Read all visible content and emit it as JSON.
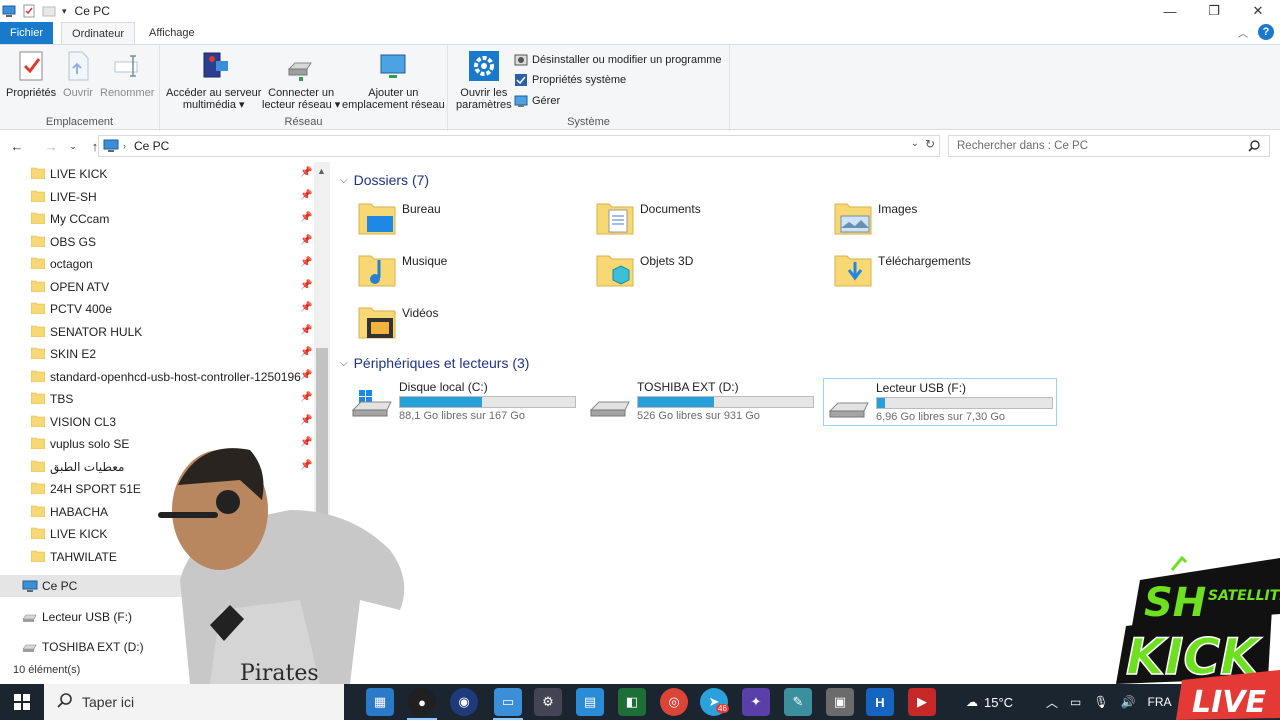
{
  "window": {
    "title": "Ce PC",
    "controls": {
      "minimize": "—",
      "maximize": "❐",
      "close": "✕"
    }
  },
  "ribbon_tabs": [
    {
      "label": "Fichier",
      "style": "file"
    },
    {
      "label": "Ordinateur",
      "style": "active"
    },
    {
      "label": "Affichage",
      "style": "normal"
    }
  ],
  "ribbon": {
    "emplacement": {
      "label": "Emplacement",
      "buttons": [
        {
          "label": "Propriétés",
          "icon": "properties-icon",
          "enabled": true
        },
        {
          "label": "Ouvrir",
          "icon": "open-icon",
          "enabled": false
        },
        {
          "label": "Renommer",
          "icon": "rename-icon",
          "enabled": false
        }
      ]
    },
    "reseau": {
      "label": "Réseau",
      "media": {
        "line1": "Accéder au serveur",
        "line2": "multimédia ▾"
      },
      "connect": {
        "line1": "Connecter un",
        "line2": "lecteur réseau ▾"
      },
      "add": {
        "line1": "Ajouter un",
        "line2": "emplacement réseau"
      }
    },
    "systeme": {
      "label": "Système",
      "settings": {
        "line1": "Ouvrir les",
        "line2": "paramètres"
      },
      "small": [
        {
          "label": "Désinstaller ou modifier un programme",
          "icon": "uninstall-icon"
        },
        {
          "label": "Propriétés système",
          "icon": "system-properties-icon"
        },
        {
          "label": "Gérer",
          "icon": "manage-icon"
        }
      ]
    }
  },
  "address": {
    "path": "Ce PC",
    "search_placeholder": "Rechercher dans : Ce PC"
  },
  "nav_pane": {
    "quick_access": [
      {
        "label": "LIVE KICK",
        "pinned": true
      },
      {
        "label": "LIVE-SH",
        "pinned": true
      },
      {
        "label": "My CCcam",
        "pinned": true
      },
      {
        "label": "OBS GS",
        "pinned": true
      },
      {
        "label": "octagon",
        "pinned": true
      },
      {
        "label": "OPEN ATV",
        "pinned": true
      },
      {
        "label": "PCTV 400e",
        "pinned": true
      },
      {
        "label": "SENATOR HULK",
        "pinned": true
      },
      {
        "label": "SKIN E2",
        "pinned": true
      },
      {
        "label": "standard-openhcd-usb-host-controller-1250196",
        "pinned": true
      },
      {
        "label": "TBS",
        "pinned": true
      },
      {
        "label": "VISION CL3",
        "pinned": true
      },
      {
        "label": "vuplus solo SE",
        "pinned": true
      },
      {
        "label": "معطيات الطبق",
        "pinned": true
      },
      {
        "label": "24H SPORT 51E",
        "pinned": false
      },
      {
        "label": "HABACHA",
        "pinned": false
      },
      {
        "label": "LIVE KICK",
        "pinned": false
      },
      {
        "label": "TAHWILATE",
        "pinned": false
      }
    ],
    "this_pc": "Ce PC",
    "devices": [
      {
        "label": "Lecteur USB (F:)"
      },
      {
        "label": "TOSHIBA EXT (D:)"
      }
    ]
  },
  "status": {
    "items": "10 élément(s)"
  },
  "content": {
    "folders_header": "Dossiers (7)",
    "folders": [
      {
        "label": "Bureau",
        "icon": "desktop-folder-icon"
      },
      {
        "label": "Documents",
        "icon": "documents-folder-icon"
      },
      {
        "label": "Images",
        "icon": "pictures-folder-icon"
      },
      {
        "label": "Musique",
        "icon": "music-folder-icon"
      },
      {
        "label": "Objets 3D",
        "icon": "3d-objects-folder-icon"
      },
      {
        "label": "Téléchargements",
        "icon": "downloads-folder-icon"
      },
      {
        "label": "Vidéos",
        "icon": "videos-folder-icon"
      }
    ],
    "devices_header": "Périphériques et lecteurs (3)",
    "drives": [
      {
        "name": "Disque local (C:)",
        "free": "88,1 Go libres sur 167 Go",
        "used_fraction": 0.47,
        "selected": false
      },
      {
        "name": "TOSHIBA EXT (D:)",
        "free": "526 Go libres sur 931 Go",
        "used_fraction": 0.435,
        "selected": false
      },
      {
        "name": "Lecteur USB (F:)",
        "free": "6,96 Go libres sur 7,30 Go",
        "used_fraction": 0.047,
        "selected": true
      }
    ]
  },
  "taskbar": {
    "search_placeholder": "Taper ici",
    "weather": "15°C",
    "language": "FRA",
    "telegram_badge": "46"
  },
  "overlay": {
    "brand_top": "SH",
    "brand_sub": "SATELLITE",
    "brand_main": "KICK",
    "brand_live": "LIVE",
    "shirt_text": "Pirates"
  },
  "colors": {
    "accent": "#1979ca",
    "drive_fill": "#26a0da",
    "folder": "#f8d775",
    "taskbar": "#1b2530",
    "brand_green": "#6ee020"
  }
}
